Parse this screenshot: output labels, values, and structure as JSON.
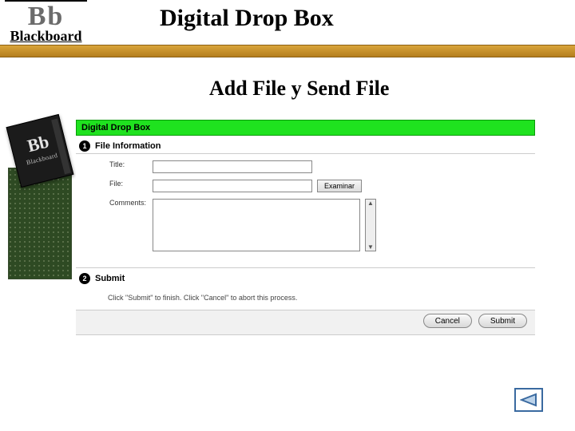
{
  "logo": {
    "bb": "Bb",
    "sub": "Blackboard"
  },
  "page_title": "Digital Drop Box",
  "subtitle": "Add File  y  Send File",
  "panel": {
    "header": "Digital Drop Box",
    "step1": {
      "num": "1",
      "title": "File Information"
    },
    "labels": {
      "title": "Title:",
      "file": "File:",
      "comments": "Comments:"
    },
    "inputs": {
      "title_value": "",
      "file_value": ""
    },
    "browse_label": "Examinar",
    "step2": {
      "num": "2",
      "title": "Submit"
    },
    "submit_hint": "Click \"Submit\" to finish. Click \"Cancel\" to abort this process.",
    "buttons": {
      "cancel": "Cancel",
      "submit": "Submit"
    }
  }
}
